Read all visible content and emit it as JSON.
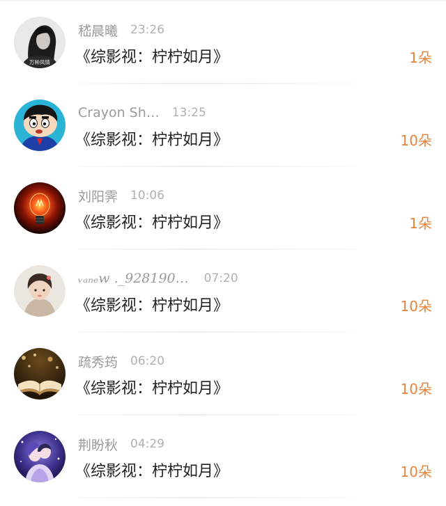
{
  "entries": [
    {
      "user": "嵇晨曦",
      "time": "23:26",
      "gift": "《综影视：柠柠如月》",
      "count": "1朵",
      "avatar_icon": "woman-portrait-avatar",
      "avatar_text": "万种风情"
    },
    {
      "user": "Crayon Sh…",
      "time": "13:25",
      "gift": "《综影视：柠柠如月》",
      "count": "10朵",
      "avatar_icon": "cartoon-boy-avatar"
    },
    {
      "user": "刘阳霁",
      "time": "10:06",
      "gift": "《综影视：柠柠如月》",
      "count": "1朵",
      "avatar_icon": "lightbulb-avatar"
    },
    {
      "user": "ᵥₐₙₑw ._928190…",
      "time": "07:20",
      "gift": "《综影视：柠柠如月》",
      "count": "10朵",
      "avatar_icon": "child-photo-avatar"
    },
    {
      "user": "疏秀筠",
      "time": "06:20",
      "gift": "《综影视：柠柠如月》",
      "count": "10朵",
      "avatar_icon": "open-book-avatar"
    },
    {
      "user": "荆盼秋",
      "time": "04:29",
      "gift": "《综影视：柠柠如月》",
      "count": "10朵",
      "avatar_icon": "anime-couple-avatar"
    }
  ],
  "colors": {
    "count": "#e8843a",
    "username": "#9a9a9a",
    "time": "#b0b0b0",
    "gift": "#222222"
  }
}
